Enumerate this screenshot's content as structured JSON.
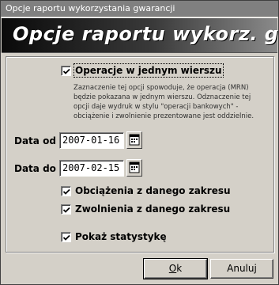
{
  "window": {
    "title": "Opcje raportu wykorzystania gwarancji"
  },
  "banner": {
    "title": "Opcje raportu wykorz. gwar."
  },
  "options": {
    "single_row": {
      "label": "Operacje w jednym wierszu",
      "checked": true,
      "description": "Zaznaczenie tej opcji spowoduje, że operacja (MRN) będzie pokazana w jednym wierszu. Odznaczenie tej opcji daje wydruk w stylu \"operacji bankowych\" - obciążenie i zwolnienie prezentowane jest oddzielnie."
    },
    "charges": {
      "label": "Obciążenia z danego zakresu",
      "checked": true
    },
    "releases": {
      "label": "Zwolnienia z danego zakresu",
      "checked": true
    },
    "stats": {
      "label": "Pokaż statystykę",
      "checked": true
    }
  },
  "date_from": {
    "label": "Data od :",
    "value": "2007-01-16"
  },
  "date_to": {
    "label": "Data do :",
    "value": "2007-02-15"
  },
  "buttons": {
    "ok_prefix": "O",
    "ok_rest": "k",
    "cancel": "Anuluj"
  },
  "icons": {
    "checkmark": "checkmark-icon",
    "calendar": "calendar-icon"
  }
}
